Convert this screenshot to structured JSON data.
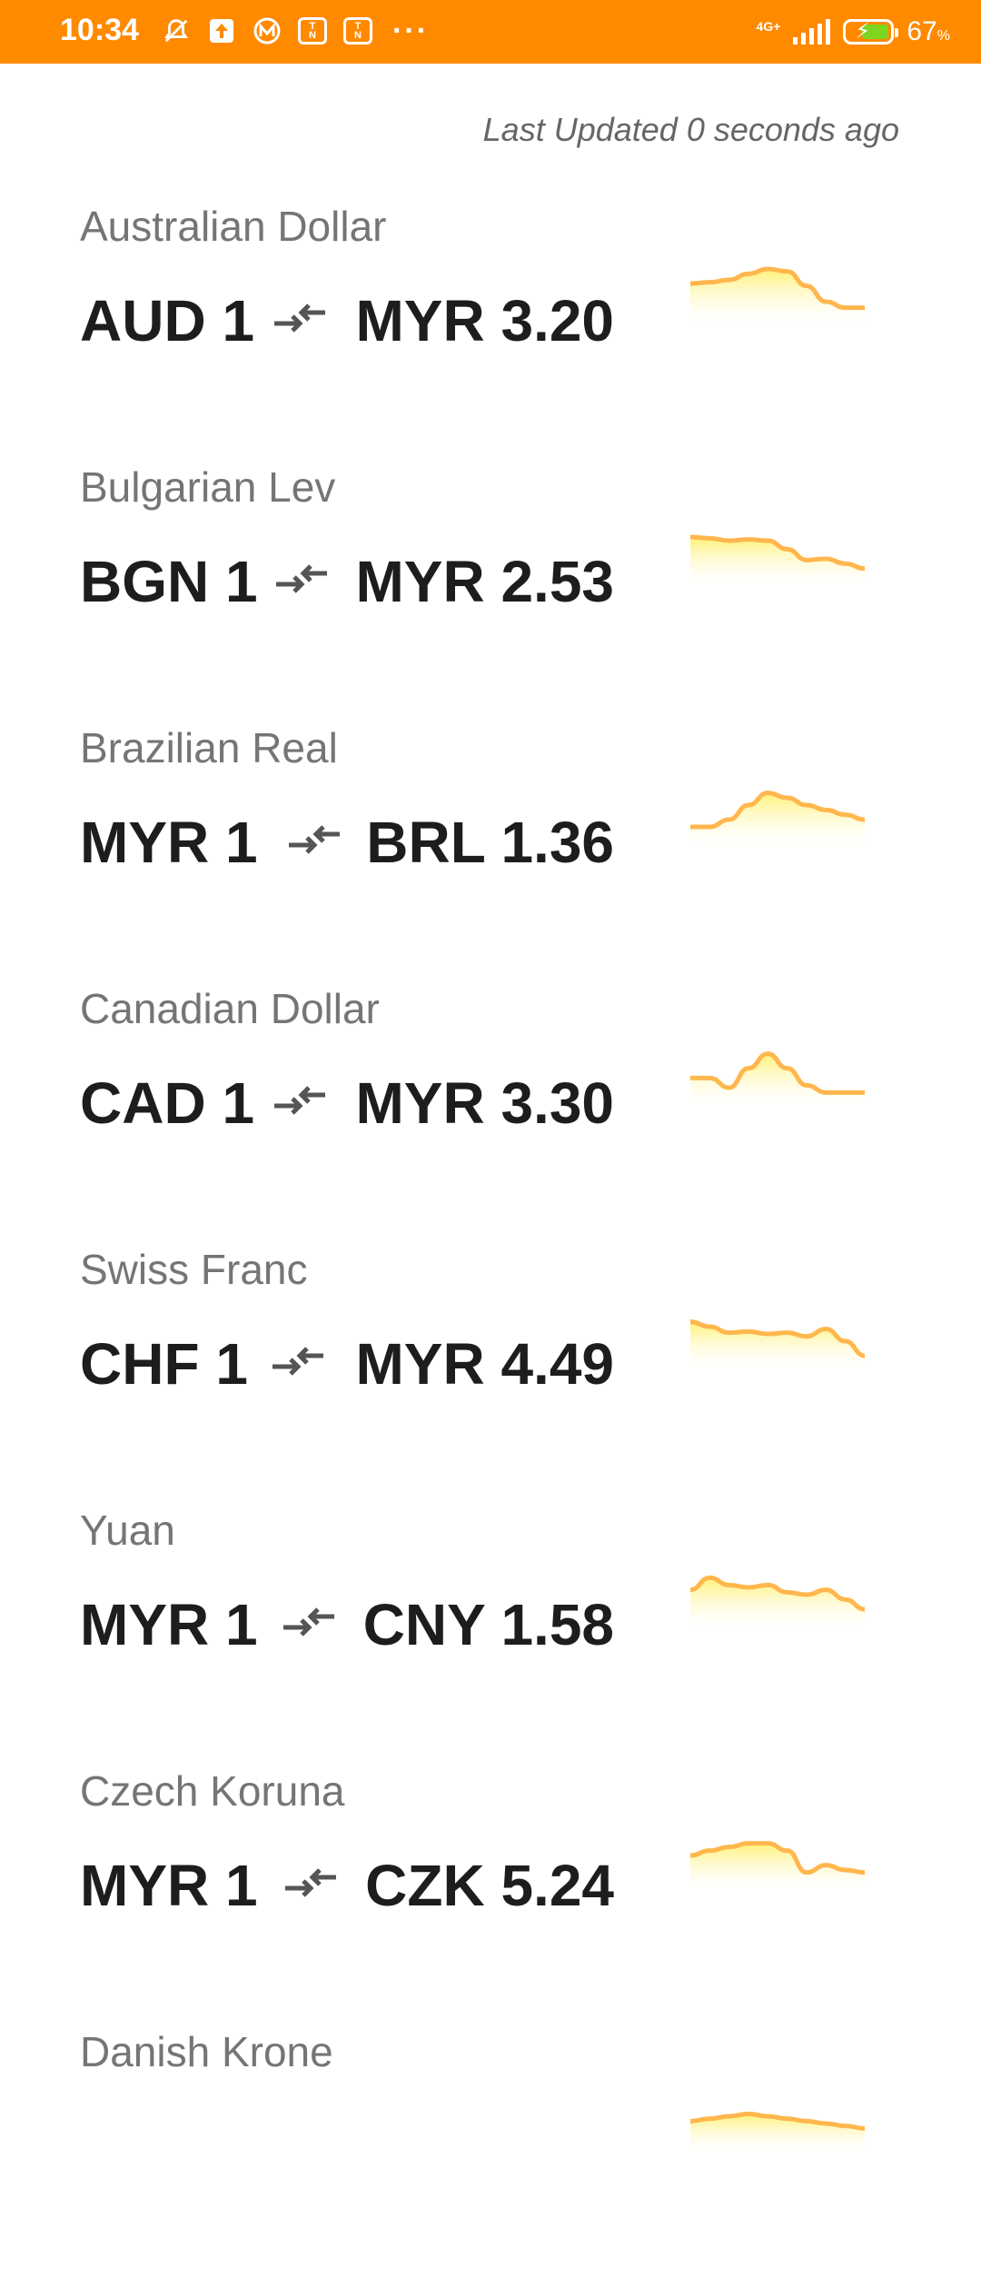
{
  "status_bar": {
    "time": "10:34",
    "network": "4G+",
    "battery_percent": "67",
    "battery_unit": "%",
    "battery_level": 0.67,
    "icons": [
      "mute-alarm-icon",
      "upload-icon",
      "m-app-icon",
      "touch-n-go-icon",
      "touch-n-go-icon",
      "more-dots-icon"
    ]
  },
  "last_updated": "Last Updated 0 seconds ago",
  "colors": {
    "status_bar": "#ff8a00",
    "spark_line": "#ffb74d",
    "spark_fill": "#fff176"
  },
  "rates": [
    {
      "name": "Australian Dollar",
      "from": "AUD 1",
      "to": "MYR 3.20",
      "trend": [
        30,
        31,
        33,
        38,
        42,
        40,
        28,
        15,
        10,
        10
      ]
    },
    {
      "name": "Bulgarian Lev",
      "from": "BGN 1",
      "to": "MYR 2.53",
      "trend": [
        36,
        35,
        33,
        34,
        33,
        26,
        17,
        18,
        14,
        10
      ]
    },
    {
      "name": "Brazilian Real",
      "from": "MYR 1",
      "to": "BRL 1.36",
      "trend": [
        12,
        12,
        18,
        30,
        40,
        36,
        30,
        26,
        22,
        18
      ]
    },
    {
      "name": "Canadian Dollar",
      "from": "CAD 1",
      "to": "MYR 3.30",
      "trend": [
        20,
        20,
        12,
        28,
        40,
        28,
        14,
        8,
        8,
        8
      ]
    },
    {
      "name": "Swiss Franc",
      "from": "CHF 1",
      "to": "MYR 4.49",
      "trend": [
        34,
        30,
        25,
        26,
        24,
        25,
        22,
        28,
        18,
        6
      ]
    },
    {
      "name": "Yuan",
      "from": "MYR 1",
      "to": "CNY 1.58",
      "trend": [
        28,
        38,
        32,
        30,
        32,
        26,
        24,
        28,
        20,
        12
      ]
    },
    {
      "name": "Czech Koruna",
      "from": "MYR 1",
      "to": "CZK 5.24",
      "trend": [
        24,
        28,
        31,
        34,
        34,
        28,
        10,
        16,
        12,
        10
      ]
    },
    {
      "name": "Danish Krone",
      "from": "",
      "to": "",
      "trend": [
        20,
        22,
        24,
        26,
        24,
        22,
        20,
        18,
        16,
        14
      ]
    }
  ]
}
